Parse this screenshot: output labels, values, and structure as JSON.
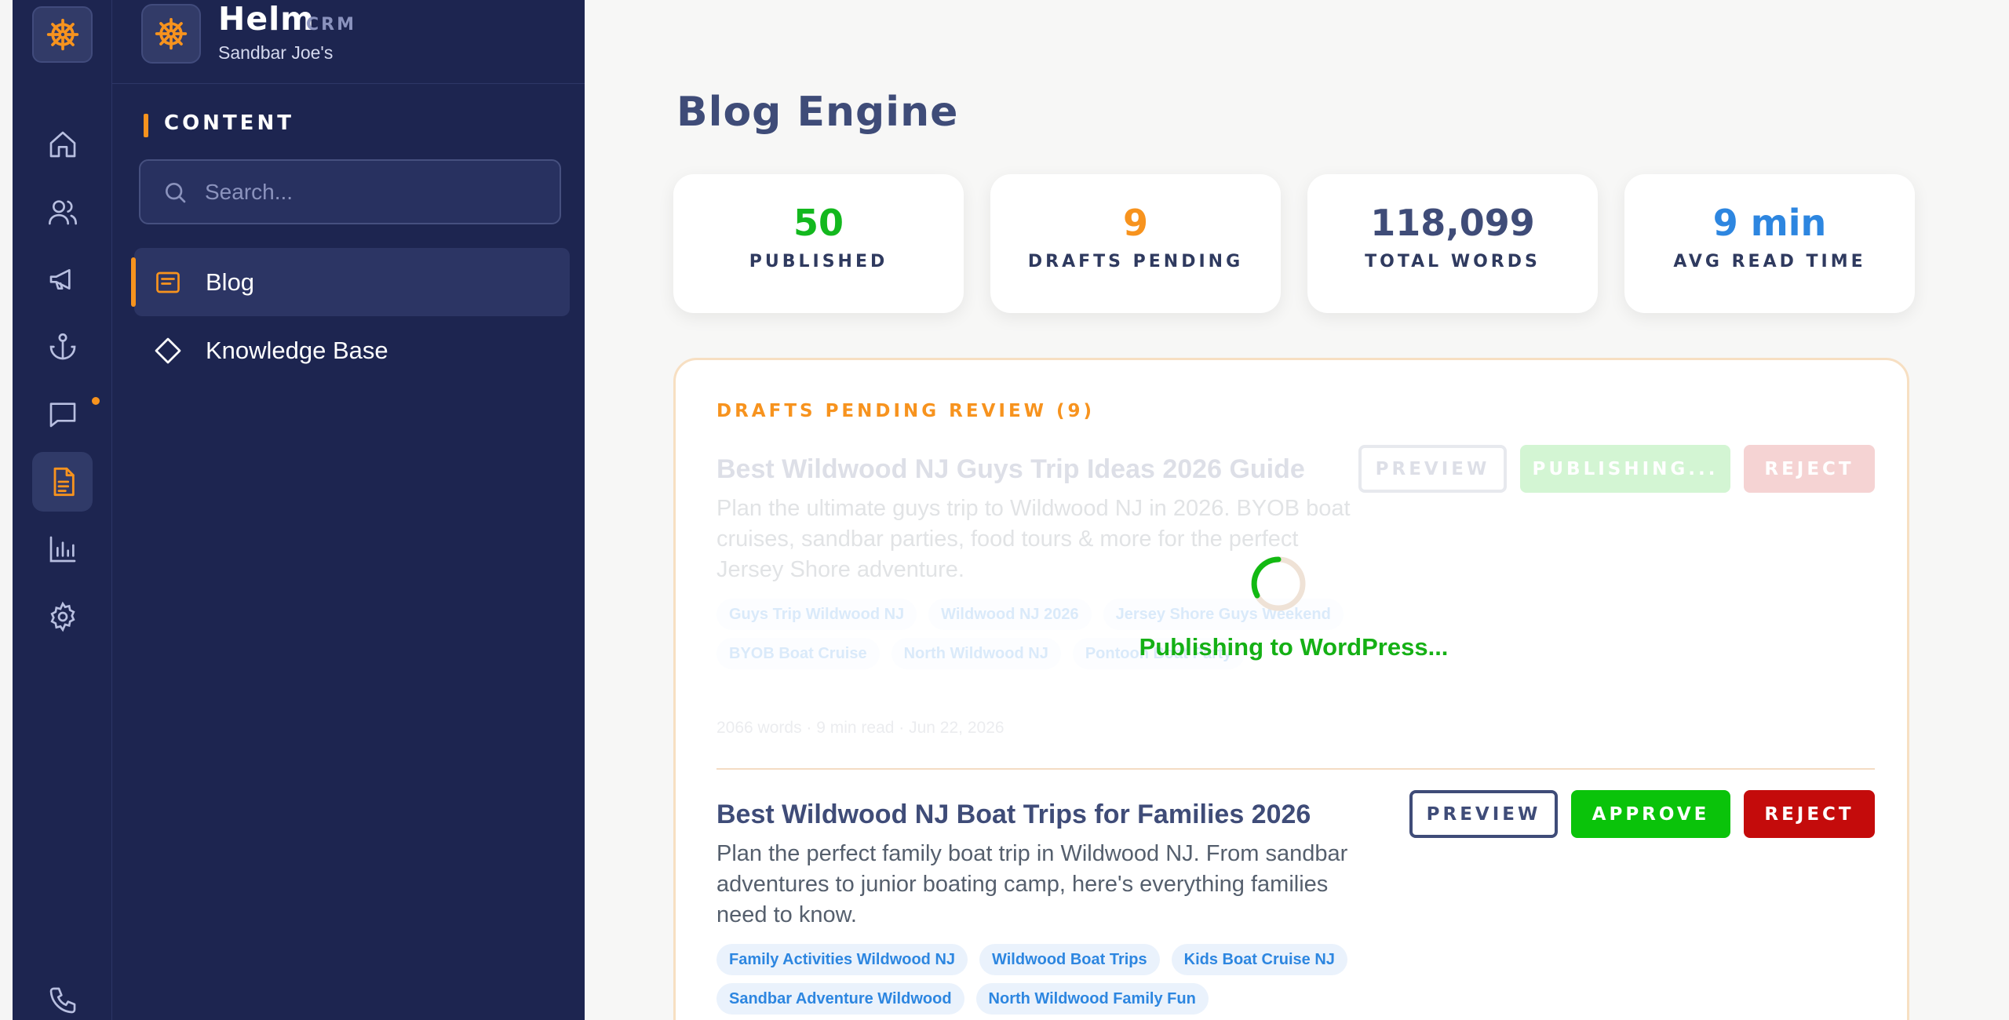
{
  "brand": {
    "name": "Helm",
    "tag": "CRM",
    "subtitle": "Sandbar Joe's"
  },
  "rail": {
    "items": [
      {
        "icon": "home-icon"
      },
      {
        "icon": "users-icon"
      },
      {
        "icon": "megaphone-icon"
      },
      {
        "icon": "anchor-icon"
      },
      {
        "icon": "chat-icon",
        "notification": true
      },
      {
        "icon": "document-icon",
        "active": true
      },
      {
        "icon": "bar-chart-icon"
      },
      {
        "icon": "settings-icon"
      },
      {
        "icon": "phone-icon"
      }
    ]
  },
  "sidebar": {
    "section_label": "CONTENT",
    "search_placeholder": "Search...",
    "items": [
      {
        "label": "Blog",
        "icon": "blog-icon",
        "active": true
      },
      {
        "label": "Knowledge Base",
        "icon": "diamond-icon",
        "active": false
      }
    ]
  },
  "main": {
    "title": "Blog Engine",
    "stats": [
      {
        "value": "50",
        "label": "PUBLISHED",
        "color": "#13b81e"
      },
      {
        "value": "9",
        "label": "DRAFTS PENDING",
        "color": "#f7931e"
      },
      {
        "value": "118,099",
        "label": "TOTAL WORDS",
        "color": "#3f4c78"
      },
      {
        "value": "9 min",
        "label": "AVG READ TIME",
        "color": "#2d86e0"
      }
    ],
    "drafts": {
      "heading": "DRAFTS PENDING REVIEW (9)",
      "loading_text": "Publishing to WordPress...",
      "posts": [
        {
          "title": "Best Wildwood NJ Guys Trip Ideas 2026 Guide",
          "description": "Plan the ultimate guys trip to Wildwood NJ in 2026. BYOB boat cruises, sandbar parties, food tours & more for the perfect Jersey Shore adventure.",
          "tags": [
            "Guys Trip Wildwood NJ",
            "Wildwood NJ 2026",
            "Jersey Shore Guys Weekend",
            "BYOB Boat Cruise",
            "North Wildwood NJ",
            "Pontoon Boat Party"
          ],
          "meta": "2066 words · 9 min read · Jun 22, 2026",
          "preview_label": "PREVIEW",
          "approve_label": "PUBLISHING...",
          "reject_label": "REJECT",
          "state": "publishing"
        },
        {
          "title": "Best Wildwood NJ Boat Trips for Families 2026",
          "description": "Plan the perfect family boat trip in Wildwood NJ. From sandbar adventures to junior boating camp, here's everything families need to know.",
          "tags": [
            "Family Activities Wildwood NJ",
            "Wildwood Boat Trips",
            "Kids Boat Cruise NJ",
            "Sandbar Adventure Wildwood",
            "North Wildwood Family Fun"
          ],
          "preview_label": "PREVIEW",
          "approve_label": "APPROVE",
          "reject_label": "REJECT",
          "state": "pending"
        }
      ]
    }
  }
}
